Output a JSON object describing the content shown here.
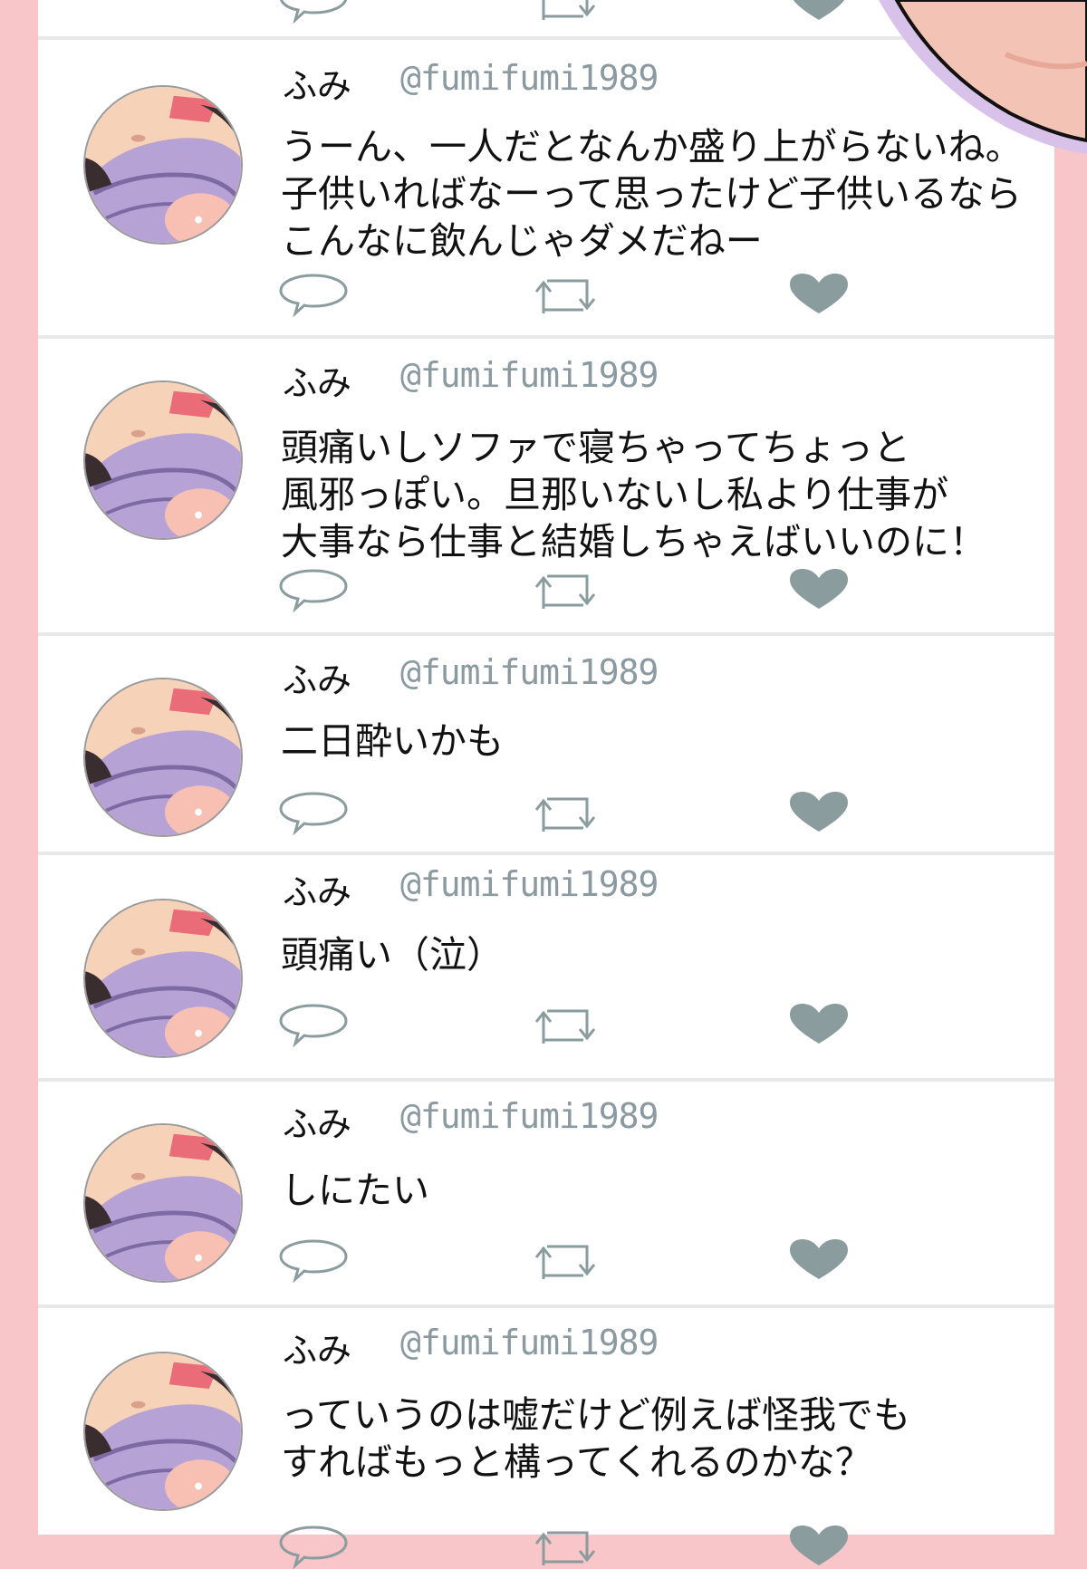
{
  "colors": {
    "frame": "#f8c6c8",
    "handle": "#8a9aa0",
    "icon": "#8a9c9e",
    "avatar_purple": "#b7a2d6"
  },
  "icons": {
    "reply": "speech-bubble-icon",
    "retweet": "retweet-icon",
    "like": "heart-icon"
  },
  "tweets": [
    {
      "name": "ふみ",
      "handle": "@fumifumi1989",
      "text": "うーん、一人だとなんか盛り上がらないね。\n子供いればなーって思ったけど子供いるなら\nこんなに飲んじゃダメだねー"
    },
    {
      "name": "ふみ",
      "handle": "@fumifumi1989",
      "text": "頭痛いしソファで寝ちゃってちょっと\n風邪っぽい。旦那いないし私より仕事が\n大事なら仕事と結婚しちゃえばいいのに！"
    },
    {
      "name": "ふみ",
      "handle": "@fumifumi1989",
      "text": "二日酔いかも"
    },
    {
      "name": "ふみ",
      "handle": "@fumifumi1989",
      "text": "頭痛い（泣）"
    },
    {
      "name": "ふみ",
      "handle": "@fumifumi1989",
      "text": "しにたい"
    },
    {
      "name": "ふみ",
      "handle": "@fumifumi1989",
      "text": "っていうのは嘘だけど例えば怪我でも\nすればもっと構ってくれるのかな？"
    }
  ]
}
